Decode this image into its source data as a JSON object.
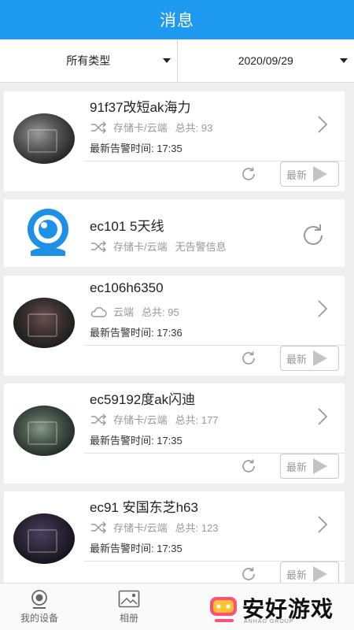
{
  "header": {
    "title": "消息"
  },
  "filters": {
    "type_label": "所有类型",
    "date_label": "2020/09/29"
  },
  "devices": [
    {
      "name": "91f37改短ak海力",
      "storage": "存储卡/云端",
      "total": "总共: 93",
      "alarm": "最新告警时间: 17:35",
      "latest": "最新"
    },
    {
      "name": "ec101 5天线",
      "storage": "存储卡/云端",
      "status": "无告警信息"
    },
    {
      "name": "ec106h6350",
      "storage": "云端",
      "total": "总共: 95",
      "alarm": "最新告警时间: 17:36",
      "latest": "最新"
    },
    {
      "name": "ec59192度ak闪迪",
      "storage": "存储卡/云端",
      "total": "总共: 177",
      "alarm": "最新告警时间: 17:35",
      "latest": "最新"
    },
    {
      "name": "ec91 安国东芝h63",
      "storage": "存储卡/云端",
      "total": "总共: 123",
      "alarm": "最新告警时间: 17:35",
      "latest": "最新"
    }
  ],
  "tabs": [
    {
      "label": "我的设备",
      "icon": "camera-icon"
    },
    {
      "label": "相册",
      "icon": "album-icon"
    }
  ],
  "watermark": {
    "text": "安好游戏",
    "sub": "ANHAO GROUP"
  },
  "colors": {
    "header": "#1e9af0",
    "logo_blue": "#1e90e6"
  }
}
